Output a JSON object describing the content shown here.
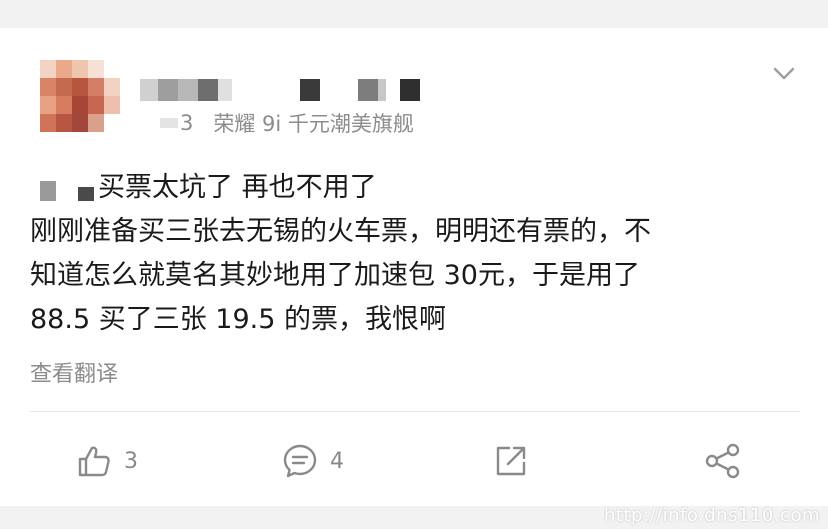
{
  "post": {
    "meta": {
      "level": "3",
      "device": "荣耀 9i 千元潮美旗舰"
    },
    "content": {
      "title_suffix": "买票太坑了 再也不用了",
      "lines": [
        "刚刚准备买三张去无锡的火车票，明明还有票的，不",
        "知道怎么就莫名其妙地用了加速包 30元，于是用了",
        "88.5 买了三张 19.5 的票，我恨啊"
      ]
    },
    "translate_label": "查看翻译",
    "actions": {
      "like_count": "3",
      "comment_count": "4"
    }
  },
  "watermark": "http://info.dns110.com",
  "icons": {
    "menu": "chevron-down-icon",
    "like": "thumbs-up-icon",
    "comment": "comment-bubble-icon",
    "repost": "share-arrow-icon",
    "share": "share-nodes-icon"
  },
  "colors": {
    "text": "#1a1a1a",
    "secondary": "#8c8c8c",
    "background": "#f2f2f2"
  }
}
